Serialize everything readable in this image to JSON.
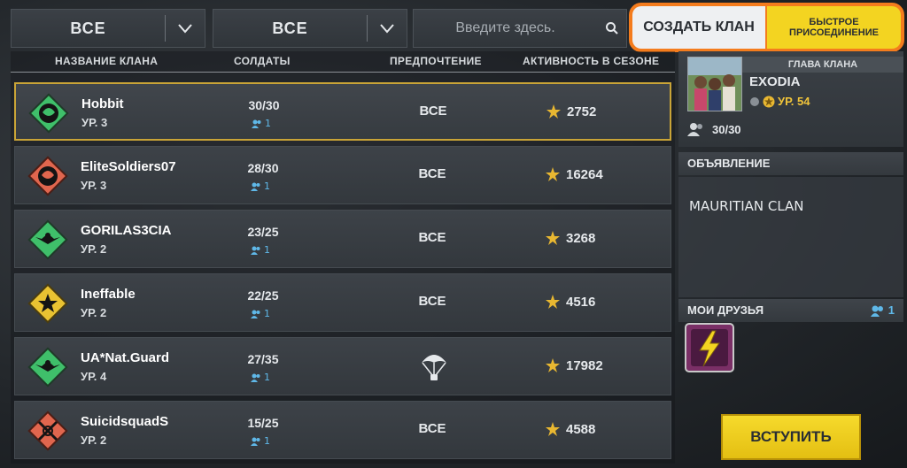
{
  "filters": {
    "region_label": "ВСЕ",
    "preference_label": "ВСЕ",
    "search_placeholder": "Введите здесь."
  },
  "actions": {
    "create_clan": "СОЗДАТЬ КЛАН",
    "quick_join": "БЫСТРОЕ ПРИСОЕДИНЕНИЕ",
    "highlight_color": "#f47c1d",
    "join": "ВСТУПИТЬ"
  },
  "table": {
    "headers": {
      "name": "НАЗВАНИЕ КЛАНА",
      "soldiers": "СОЛДАТЫ",
      "preference": "ПРЕДПОЧТЕНИЕ",
      "activity": "АКТИВНОСТЬ В СЕЗОНЕ"
    },
    "rows": [
      {
        "name": "Hobbit",
        "level": "УР. 3",
        "soldiers": "30/30",
        "friends": "1",
        "preference": "ВСЕ",
        "activity": "2752",
        "badge_color": "#3fbf6a",
        "badge_icon": "dragon-emblem-icon"
      },
      {
        "name": "EliteSoldiers07",
        "level": "УР. 3",
        "soldiers": "28/30",
        "friends": "1",
        "preference": "ВСЕ",
        "activity": "16264",
        "badge_color": "#e0664e",
        "badge_icon": "dragon-emblem-icon"
      },
      {
        "name": "GORILAS3CIA",
        "level": "УР. 2",
        "soldiers": "23/25",
        "friends": "1",
        "preference": "ВСЕ",
        "activity": "3268",
        "badge_color": "#3fbf6a",
        "badge_icon": "eagle-emblem-icon"
      },
      {
        "name": "Ineffable",
        "level": "УР. 2",
        "soldiers": "22/25",
        "friends": "1",
        "preference": "ВСЕ",
        "activity": "4516",
        "badge_color": "#e9c232",
        "badge_icon": "star-emblem-icon"
      },
      {
        "name": "UA*Nat.Guard",
        "level": "УР. 4",
        "soldiers": "27/35",
        "friends": "1",
        "preference": "",
        "preference_icon": "parachute-icon",
        "activity": "17982",
        "badge_color": "#3fbf6a",
        "badge_icon": "eagle-emblem-icon"
      },
      {
        "name": "SuicidsquadS",
        "level": "УР. 2",
        "soldiers": "15/25",
        "friends": "1",
        "preference": "ВСЕ",
        "activity": "4588",
        "badge_color": "#e0664e",
        "badge_icon": "crossed-guns-emblem-icon"
      }
    ]
  },
  "leader": {
    "label": "ГЛАВА КЛАНА",
    "name": "EXODIA",
    "level": "УР. 54",
    "members": "30/30"
  },
  "announcement": {
    "title": "ОБЪЯВЛЕНИЕ",
    "text": "MAURITIAN CLAN"
  },
  "my_friends": {
    "title": "МОИ ДРУЗЬЯ",
    "count": "1"
  },
  "colors": {
    "selected_border": "#c9a437",
    "join_button": "#f3d421",
    "friends_accent": "#5fb8e8"
  }
}
